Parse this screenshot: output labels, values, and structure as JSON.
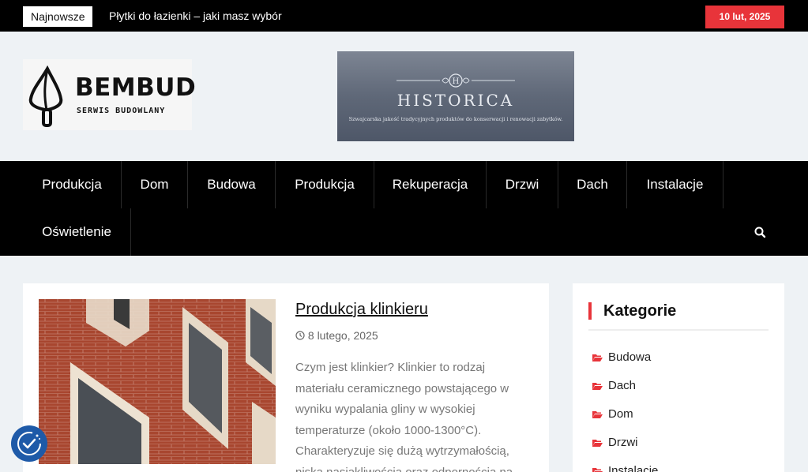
{
  "topbar": {
    "latest_label": "Najnowsze",
    "ticker_text": "Płytki do łazienki – jaki masz wybór",
    "date": "10 lut, 2025"
  },
  "logo": {
    "name": "BEMBUD",
    "tagline": "SERWIS BUDOWLANY"
  },
  "banner": {
    "title": "HISTORICA",
    "subtitle": "Szwajcarska jakość tradycyjnych produktów do konserwacji i renowacji zabytków."
  },
  "nav": {
    "items": [
      "Produkcja",
      "Dom",
      "Budowa",
      "Produkcja",
      "Rekuperacja",
      "Drzwi",
      "Dach",
      "Instalacje",
      "Oświetlenie"
    ]
  },
  "post": {
    "title": "Produkcja klinkieru",
    "date": "8 lutego, 2025",
    "excerpt": "Czym jest klinkier? Klinkier to rodzaj materiału ceramicznego powstającego w wyniku wypalania gliny w wysokiej temperaturze (około 1000-1300°C). Charakteryzuje się dużą wytrzymałością, niską nasiąkliwością oraz odpornością na"
  },
  "sidebar": {
    "title": "Kategorie",
    "categories": [
      "Budowa",
      "Dach",
      "Dom",
      "Drzwi",
      "Instalacje"
    ]
  },
  "colors": {
    "accent": "#e8343a",
    "nav_bg": "#000000",
    "page_bg": "#eef2f5"
  }
}
